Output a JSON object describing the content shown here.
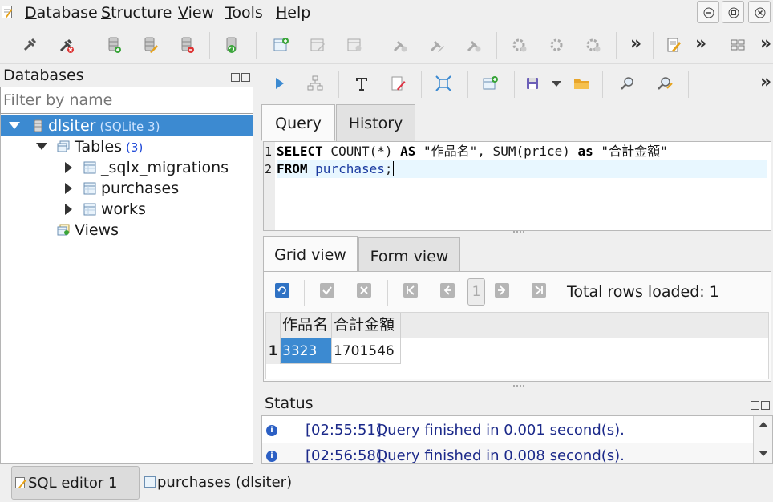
{
  "menubar": {
    "items": [
      {
        "label": "Database",
        "mnemonic": "D"
      },
      {
        "label": "Structure",
        "mnemonic": "S"
      },
      {
        "label": "View",
        "mnemonic": "V"
      },
      {
        "label": "Tools",
        "mnemonic": "T"
      },
      {
        "label": "Help",
        "mnemonic": "H"
      }
    ]
  },
  "db_panel": {
    "title": "Databases",
    "filter_placeholder": "Filter by name",
    "tree": {
      "database": {
        "label": "dlsiter",
        "badge": "(SQLite 3)"
      },
      "tables": {
        "label": "Tables",
        "badge": "(3)"
      },
      "table_items": [
        "_sqlx_migrations",
        "purchases",
        "works"
      ],
      "views": {
        "label": "Views"
      }
    }
  },
  "query_tabs": [
    "Query",
    "History"
  ],
  "editor": {
    "line_numbers": [
      "1",
      "2"
    ],
    "line1": {
      "kw1": "SELECT",
      "t1": " COUNT(*) ",
      "kw2": "AS",
      "t2": " \"作品名\", SUM(price) ",
      "kw3": "as",
      "t3": " \"合計金額\""
    },
    "line2": {
      "kw1": "FROM",
      "t1": " ",
      "id": "purchases",
      "t2": ";"
    }
  },
  "result_tabs": [
    "Grid view",
    "Form view"
  ],
  "result_toolbar": {
    "page": "1",
    "rows_loaded": "Total rows loaded: 1"
  },
  "grid": {
    "columns": [
      "作品名",
      "合計金額"
    ],
    "rows": [
      {
        "num": "1",
        "cells": [
          "3323",
          "1701546"
        ]
      }
    ]
  },
  "status": {
    "title": "Status",
    "rows": [
      {
        "time": "[02:55:51]",
        "msg": "Query finished in 0.001 second(s)."
      },
      {
        "time": "[02:56:58]",
        "msg": "Query finished in 0.008 second(s)."
      }
    ]
  },
  "bottom_tabs": [
    "SQL editor 1",
    "purchases (dlsiter)"
  ],
  "colors": {
    "selection": "#3c8ad1",
    "keyword": "#000000",
    "identifier": "#1c3ba0",
    "status_text": "#1c2a8a"
  },
  "icons": [
    "connect-icon",
    "disconnect-icon",
    "add-database-icon",
    "edit-database-icon",
    "remove-database-icon",
    "refresh-database-icon",
    "add-table-icon",
    "edit-table-icon",
    "drop-table-icon",
    "add-column-icon",
    "edit-column-icon",
    "drop-column-icon",
    "add-index-icon",
    "edit-index-icon",
    "drop-index-icon",
    "new-sql-editor-icon",
    "tile-windows-icon"
  ]
}
